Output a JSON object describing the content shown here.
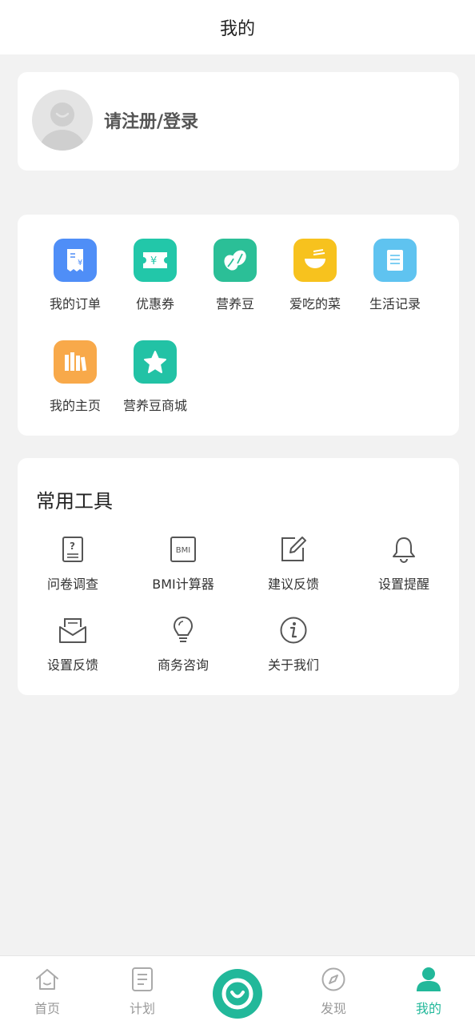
{
  "header": {
    "title": "我的"
  },
  "profile": {
    "login_label": "请注册/登录"
  },
  "services": [
    {
      "label": "我的订单",
      "icon": "receipt-icon",
      "color": "#4f8ef7"
    },
    {
      "label": "优惠券",
      "icon": "coupon-icon",
      "color": "#22c7a9"
    },
    {
      "label": "营养豆",
      "icon": "bean-icon",
      "color": "#2bbf97"
    },
    {
      "label": "爱吃的菜",
      "icon": "bowl-icon",
      "color": "#f7c21e"
    },
    {
      "label": "生活记录",
      "icon": "scroll-icon",
      "color": "#5fc3f0"
    },
    {
      "label": "我的主页",
      "icon": "bookshelf-icon",
      "color": "#f8a94a"
    },
    {
      "label": "营养豆商城",
      "icon": "star-icon",
      "color": "#22c2a5"
    }
  ],
  "tools": {
    "title": "常用工具",
    "items": [
      {
        "label": "问卷调查",
        "icon": "questionnaire-icon"
      },
      {
        "label": "BMI计算器",
        "icon": "bmi-icon",
        "icon_text": "BMI"
      },
      {
        "label": "建议反馈",
        "icon": "edit-icon"
      },
      {
        "label": "设置提醒",
        "icon": "bell-icon"
      },
      {
        "label": "设置反馈",
        "icon": "envelope-icon"
      },
      {
        "label": "商务咨询",
        "icon": "lightbulb-icon"
      },
      {
        "label": "关于我们",
        "icon": "info-icon"
      }
    ]
  },
  "tabbar": {
    "items": [
      {
        "label": "首页",
        "icon": "home-icon"
      },
      {
        "label": "计划",
        "icon": "plan-icon"
      },
      {
        "label": "发现",
        "icon": "compass-icon"
      },
      {
        "label": "我的",
        "icon": "user-icon",
        "active": true
      }
    ],
    "active_color": "#22b89a"
  }
}
